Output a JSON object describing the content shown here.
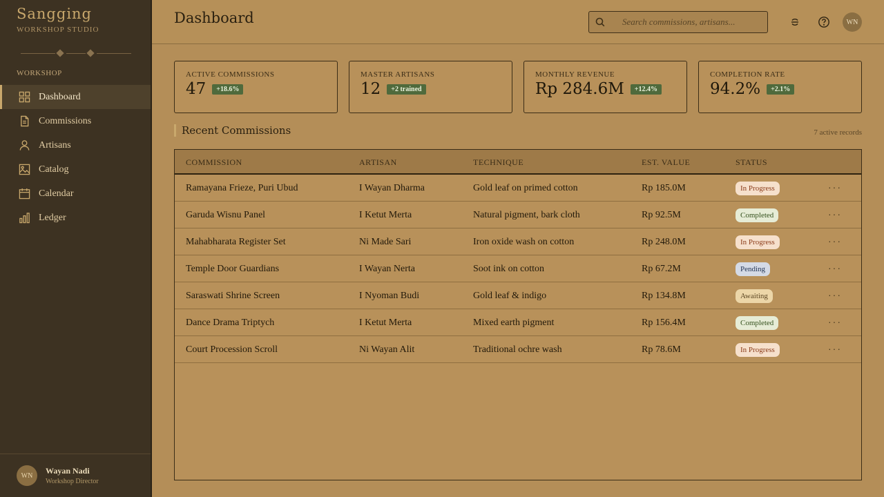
{
  "brand": {
    "name": "Sangging",
    "subtitle": "WORKSHOP STUDIO"
  },
  "sidebar": {
    "section_label": "WORKSHOP",
    "items": [
      {
        "label": "Dashboard",
        "icon": "grid-icon",
        "active": true
      },
      {
        "label": "Commissions",
        "icon": "document-icon",
        "active": false
      },
      {
        "label": "Artisans",
        "icon": "person-icon",
        "active": false
      },
      {
        "label": "Catalog",
        "icon": "image-icon",
        "active": false
      },
      {
        "label": "Calendar",
        "icon": "calendar-icon",
        "active": false
      },
      {
        "label": "Ledger",
        "icon": "bar-chart-icon",
        "active": false
      }
    ],
    "user": {
      "initials": "WN",
      "name": "Wayan Nadi",
      "role": "Workshop Director"
    }
  },
  "header": {
    "title": "Dashboard",
    "search_placeholder": "Search commissions, artisans...",
    "avatar_initials": "WN"
  },
  "kpis": [
    {
      "label": "ACTIVE COMMISSIONS",
      "value": "47",
      "badge": "+18.6%"
    },
    {
      "label": "MASTER ARTISANS",
      "value": "12",
      "badge": "+2 trained"
    },
    {
      "label": "MONTHLY REVENUE",
      "value": "Rp 284.6M",
      "badge": "+12.4%"
    },
    {
      "label": "COMPLETION RATE",
      "value": "94.2%",
      "badge": "+2.1%"
    }
  ],
  "recent": {
    "title": "Recent Commissions",
    "records_note": "7 active records",
    "columns": [
      "COMMISSION",
      "ARTISAN",
      "TECHNIQUE",
      "EST. VALUE",
      "STATUS"
    ],
    "rows": [
      {
        "commission": "Ramayana Frieze, Puri Ubud",
        "artisan": "I Wayan Dharma",
        "technique": "Gold leaf on primed cotton",
        "value": "Rp 185.0M",
        "status": "In Progress"
      },
      {
        "commission": "Garuda Wisnu Panel",
        "artisan": "I Ketut Merta",
        "technique": "Natural pigment, bark cloth",
        "value": "Rp 92.5M",
        "status": "Completed"
      },
      {
        "commission": "Mahabharata Register Set",
        "artisan": "Ni Made Sari",
        "technique": "Iron oxide wash on cotton",
        "value": "Rp 248.0M",
        "status": "In Progress"
      },
      {
        "commission": "Temple Door Guardians",
        "artisan": "I Wayan Nerta",
        "technique": "Soot ink on cotton",
        "value": "Rp 67.2M",
        "status": "Pending"
      },
      {
        "commission": "Saraswati Shrine Screen",
        "artisan": "I Nyoman Budi",
        "technique": "Gold leaf & indigo",
        "value": "Rp 134.8M",
        "status": "Awaiting"
      },
      {
        "commission": "Dance Drama Triptych",
        "artisan": "I Ketut Merta",
        "technique": "Mixed earth pigment",
        "value": "Rp 156.4M",
        "status": "Completed"
      },
      {
        "commission": "Court Procession Scroll",
        "artisan": "Ni Wayan Alit",
        "technique": "Traditional ochre wash",
        "value": "Rp 78.6M",
        "status": "In Progress"
      }
    ],
    "more_label": "···"
  },
  "status_colors": {
    "In Progress": {
      "bg": "#f6e0cc",
      "fg": "#8a3a18"
    },
    "Completed": {
      "bg": "#e6ecd6",
      "fg": "#34501c"
    },
    "Pending": {
      "bg": "#d4dae6",
      "fg": "#243656"
    },
    "Awaiting": {
      "bg": "#ecd6a8",
      "fg": "#5a4420"
    }
  }
}
